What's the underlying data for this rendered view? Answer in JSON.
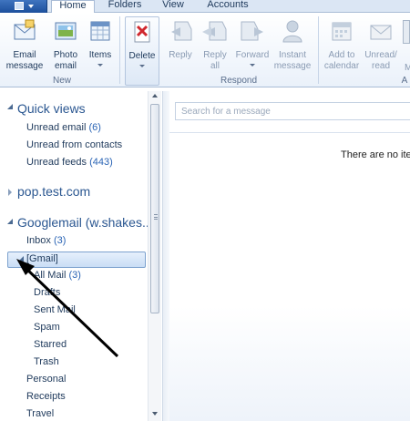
{
  "tabs": [
    {
      "label": "Home",
      "active": true
    },
    {
      "label": "Folders",
      "active": false
    },
    {
      "label": "View",
      "active": false
    },
    {
      "label": "Accounts",
      "active": false
    }
  ],
  "ribbon": {
    "groups": {
      "new": "New",
      "respond": "Respond",
      "actions_partial": "A"
    },
    "buttons": {
      "email_message": {
        "line1": "Email",
        "line2": "message",
        "icon": "email-message-icon"
      },
      "photo_email": {
        "line1": "Photo",
        "line2": "email",
        "icon": "photo-email-icon"
      },
      "items": {
        "line1": "Items",
        "icon": "items-icon"
      },
      "delete": {
        "line1": "Delete",
        "icon": "delete-icon"
      },
      "reply": {
        "line1": "Reply",
        "icon": "reply-icon"
      },
      "reply_all": {
        "line1": "Reply",
        "line2": "all",
        "icon": "reply-all-icon"
      },
      "forward": {
        "line1": "Forward",
        "icon": "forward-icon"
      },
      "instant_message": {
        "line1": "Instant",
        "line2": "message",
        "icon": "instant-message-icon"
      },
      "add_to_calendar": {
        "line1": "Add to",
        "line2": "calendar",
        "icon": "calendar-icon"
      },
      "unread_read": {
        "line1": "Unread/",
        "line2": "read",
        "icon": "unread-read-icon"
      }
    }
  },
  "folders": {
    "quick_views": {
      "title": "Quick views",
      "items": [
        {
          "label": "Unread email",
          "count": "(6)"
        },
        {
          "label": "Unread from contacts",
          "count": ""
        },
        {
          "label": "Unread feeds",
          "count": "(443)"
        }
      ]
    },
    "pop_account": {
      "title": "pop.test.com"
    },
    "googlemail": {
      "title": "Googlemail (w.shakes...",
      "inbox": {
        "label": "Inbox",
        "count": "(3)"
      },
      "gmail": {
        "label": "[Gmail]"
      },
      "gmail_children": [
        {
          "label": "All Mail",
          "count": "(3)"
        },
        {
          "label": "Drafts",
          "count": ""
        },
        {
          "label": "Sent Mail",
          "count": ""
        },
        {
          "label": "Spam",
          "count": ""
        },
        {
          "label": "Starred",
          "count": ""
        },
        {
          "label": "Trash",
          "count": ""
        }
      ],
      "others": [
        {
          "label": "Personal"
        },
        {
          "label": "Receipts"
        },
        {
          "label": "Travel"
        }
      ]
    }
  },
  "message_list": {
    "search_placeholder": "Search for a message",
    "empty_text": "There are no iter"
  },
  "colors": {
    "accent": "#2b5791",
    "count": "#2a64b5",
    "annotation_arrow": "#000000"
  }
}
